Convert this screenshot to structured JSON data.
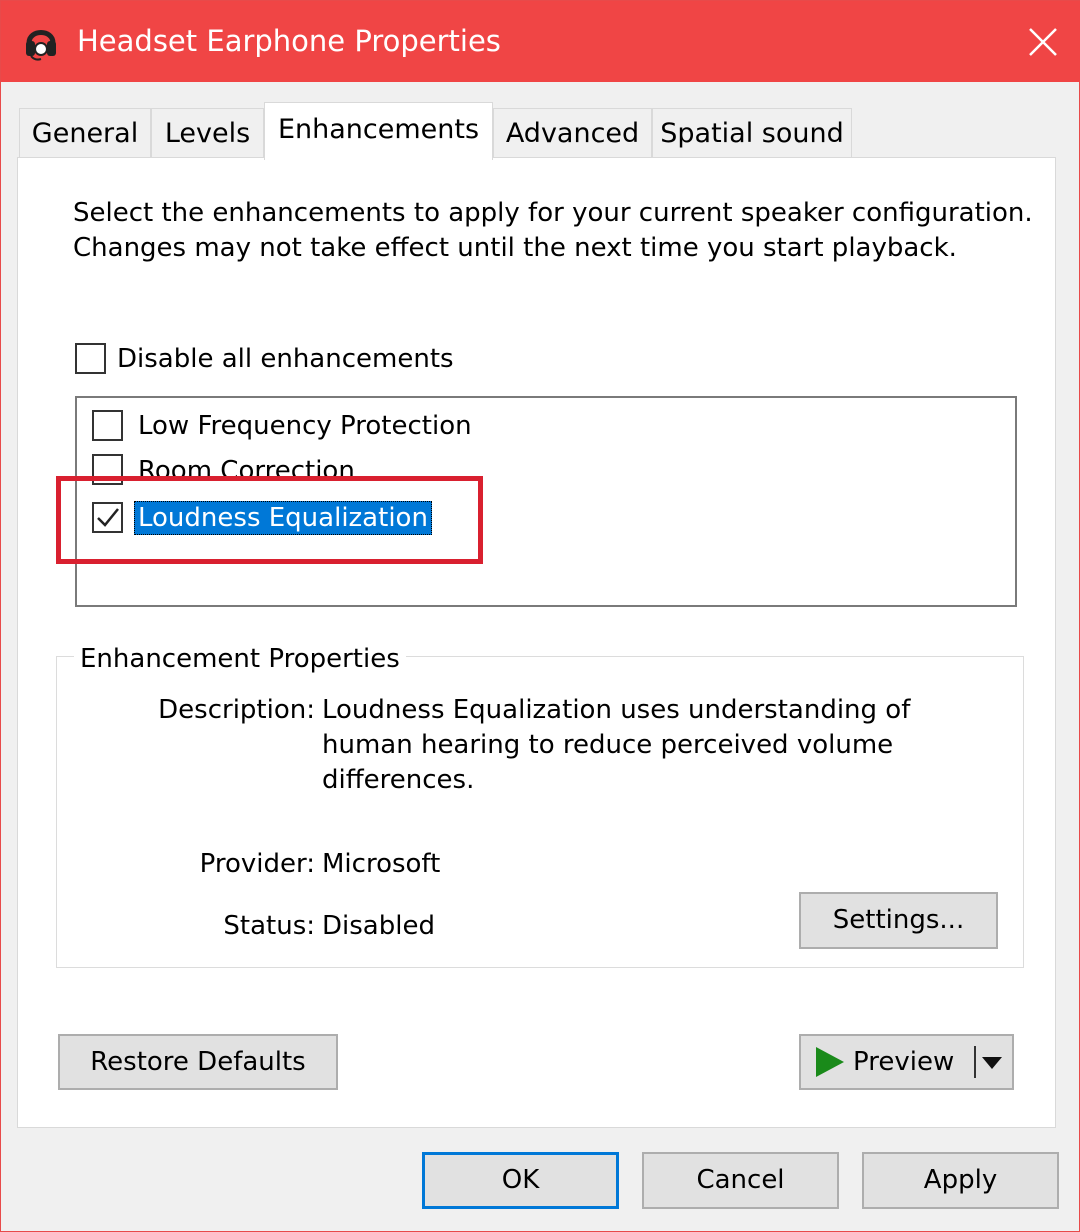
{
  "window": {
    "title": "Headset Earphone Properties",
    "app_icon": "headset-icon",
    "close_icon": "close-icon",
    "titlebar_color": "#f04545"
  },
  "tabs": [
    {
      "label": "General"
    },
    {
      "label": "Levels"
    },
    {
      "label": "Enhancements",
      "active": true
    },
    {
      "label": "Advanced"
    },
    {
      "label": "Spatial sound"
    }
  ],
  "enhancements": {
    "intro": "Select the enhancements to apply for your current speaker configuration. Changes may not take effect until the next time you start playback.",
    "disable_all": {
      "label": "Disable all enhancements",
      "checked": false
    },
    "items": [
      {
        "label": "Low Frequency Protection",
        "checked": false
      },
      {
        "label": "Room Correction",
        "checked": false
      },
      {
        "label": "Loudness Equalization",
        "checked": true,
        "selected": true
      }
    ],
    "highlight_color": "#d9202f",
    "selection_color": "#0078d7"
  },
  "properties": {
    "group_title": "Enhancement Properties",
    "description_label": "Description:",
    "description_value": "Loudness Equalization uses understanding of human hearing to reduce perceived volume differences.",
    "provider_label": "Provider:",
    "provider_value": "Microsoft",
    "status_label": "Status:",
    "status_value": "Disabled",
    "settings_button": "Settings..."
  },
  "actions": {
    "restore_defaults": "Restore Defaults",
    "preview": "Preview",
    "ok": "OK",
    "cancel": "Cancel",
    "apply": "Apply"
  }
}
